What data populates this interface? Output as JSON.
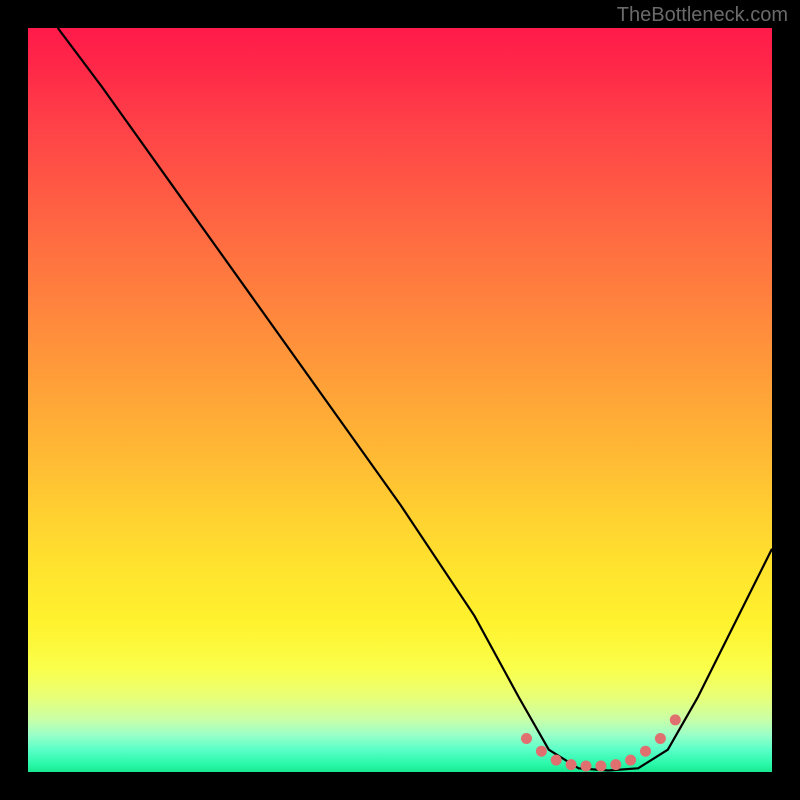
{
  "watermark": "TheBottleneck.com",
  "chart_data": {
    "type": "line",
    "title": "",
    "xlabel": "",
    "ylabel": "",
    "xlim": [
      0,
      100
    ],
    "ylim": [
      0,
      100
    ],
    "series": [
      {
        "name": "bottleneck-curve",
        "x": [
          4,
          10,
          20,
          30,
          40,
          50,
          60,
          66,
          70,
          74,
          78,
          82,
          86,
          90,
          100
        ],
        "y": [
          100,
          92,
          78,
          64,
          50,
          36,
          21,
          10,
          3,
          0.5,
          0.2,
          0.5,
          3,
          10,
          30
        ],
        "color": "#000000"
      },
      {
        "name": "optimal-range-dots",
        "x": [
          67,
          69,
          71,
          73,
          75,
          77,
          79,
          81,
          83,
          85,
          87
        ],
        "y": [
          4.5,
          2.8,
          1.6,
          1.0,
          0.8,
          0.8,
          1.0,
          1.6,
          2.8,
          4.5,
          7
        ],
        "color": "#e07070"
      }
    ],
    "gradient_stops": [
      {
        "pos": 0,
        "color": "#ff1a4a"
      },
      {
        "pos": 50,
        "color": "#ffa338"
      },
      {
        "pos": 80,
        "color": "#fff22e"
      },
      {
        "pos": 100,
        "color": "#18e890"
      }
    ]
  }
}
